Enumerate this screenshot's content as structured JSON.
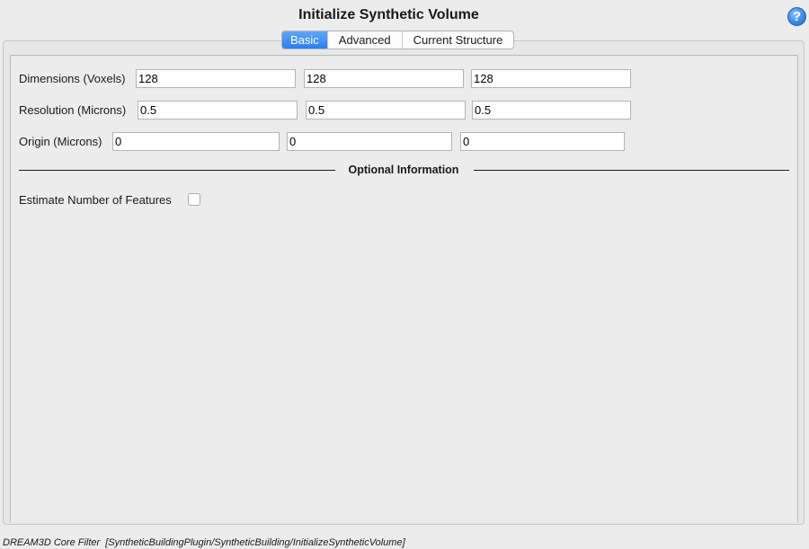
{
  "window": {
    "title": "Initialize Synthetic Volume"
  },
  "help_icon": "help-icon",
  "tabs": [
    {
      "label": "Basic",
      "active": true
    },
    {
      "label": "Advanced",
      "active": false
    },
    {
      "label": "Current Structure",
      "active": false
    }
  ],
  "basic": {
    "dimensions": {
      "label": "Dimensions (Voxels)",
      "values": [
        "128",
        "128",
        "128"
      ]
    },
    "resolution": {
      "label": "Resolution (Microns)",
      "values": [
        "0.5",
        "0.5",
        "0.5"
      ]
    },
    "origin": {
      "label": "Origin (Microns)",
      "values": [
        "0",
        "0",
        "0"
      ]
    },
    "optional_section": {
      "title": "Optional Information"
    },
    "estimate_features": {
      "label": "Estimate Number of Features",
      "checked": false
    }
  },
  "footer": {
    "filter_type": "DREAM3D Core Filter",
    "path": "[SyntheticBuildingPlugin/SyntheticBuilding/InitializeSyntheticVolume]"
  },
  "colors": {
    "accent": "#2a7ff0",
    "background": "#ececec"
  }
}
